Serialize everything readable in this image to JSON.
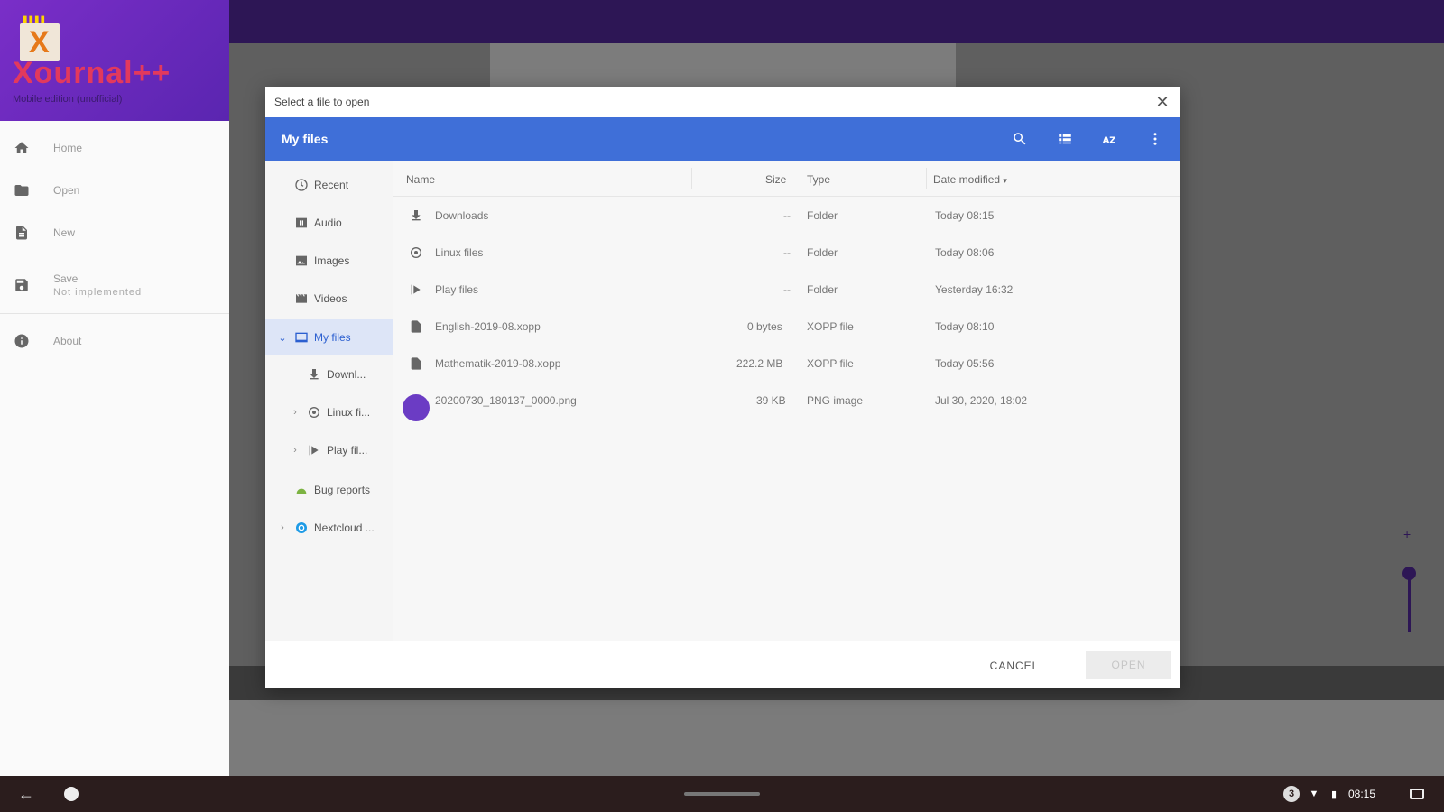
{
  "drawer": {
    "app_name": "Xournal++",
    "tagline": "Mobile edition (unofficial)",
    "items": [
      {
        "label": "Home",
        "icon": "home-icon"
      },
      {
        "label": "Open",
        "icon": "folder-icon"
      },
      {
        "label": "New",
        "icon": "file-icon"
      },
      {
        "label": "Save",
        "sub": "Not implemented",
        "icon": "save-icon"
      },
      {
        "label": "About",
        "icon": "info-icon"
      }
    ]
  },
  "dialog": {
    "title": "Select a file to open",
    "breadcrumb": "My files",
    "nav": [
      {
        "label": "Recent"
      },
      {
        "label": "Audio"
      },
      {
        "label": "Images"
      },
      {
        "label": "Videos"
      },
      {
        "label": "My files"
      },
      {
        "label": "Downl..."
      },
      {
        "label": "Linux fi..."
      },
      {
        "label": "Play fil..."
      },
      {
        "label": "Bug reports"
      },
      {
        "label": "Nextcloud ..."
      }
    ],
    "columns": {
      "name": "Name",
      "size": "Size",
      "type": "Type",
      "date": "Date modified"
    },
    "files": [
      {
        "name": "Downloads",
        "size": "--",
        "type": "Folder",
        "date": "Today 08:15"
      },
      {
        "name": "Linux files",
        "size": "--",
        "type": "Folder",
        "date": "Today 08:06"
      },
      {
        "name": "Play files",
        "size": "--",
        "type": "Folder",
        "date": "Yesterday 16:32"
      },
      {
        "name": "English-2019-08.xopp",
        "size": "0 bytes",
        "type": "XOPP file",
        "date": "Today 08:10"
      },
      {
        "name": "Mathematik-2019-08.xopp",
        "size": "222.2 MB",
        "type": "XOPP file",
        "date": "Today 05:56"
      },
      {
        "name": "20200730_180137_0000.png",
        "size": "39 KB",
        "type": "PNG image",
        "date": "Jul 30, 2020, 18:02"
      }
    ],
    "cancel_label": "CANCEL",
    "open_label": "OPEN"
  },
  "shelf": {
    "notification_count": "3",
    "time": "08:15"
  },
  "colors": {
    "accent": "#3f6fd8",
    "drawer_header": "#6a2bc0",
    "app_topbar": "#2d1655"
  }
}
